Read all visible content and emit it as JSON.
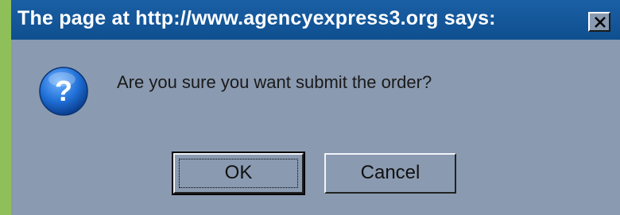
{
  "dialog": {
    "title": "The page at http://www.agencyexpress3.org says:",
    "message": "Are you sure you want submit the order?",
    "ok_label": "OK",
    "cancel_label": "Cancel",
    "icon": "question-icon"
  },
  "colors": {
    "page_background": "#8fbf58",
    "titlebar": "#1a5fa5",
    "dialog_background": "#8a9ab0",
    "icon_blue": "#1f6fd6"
  }
}
